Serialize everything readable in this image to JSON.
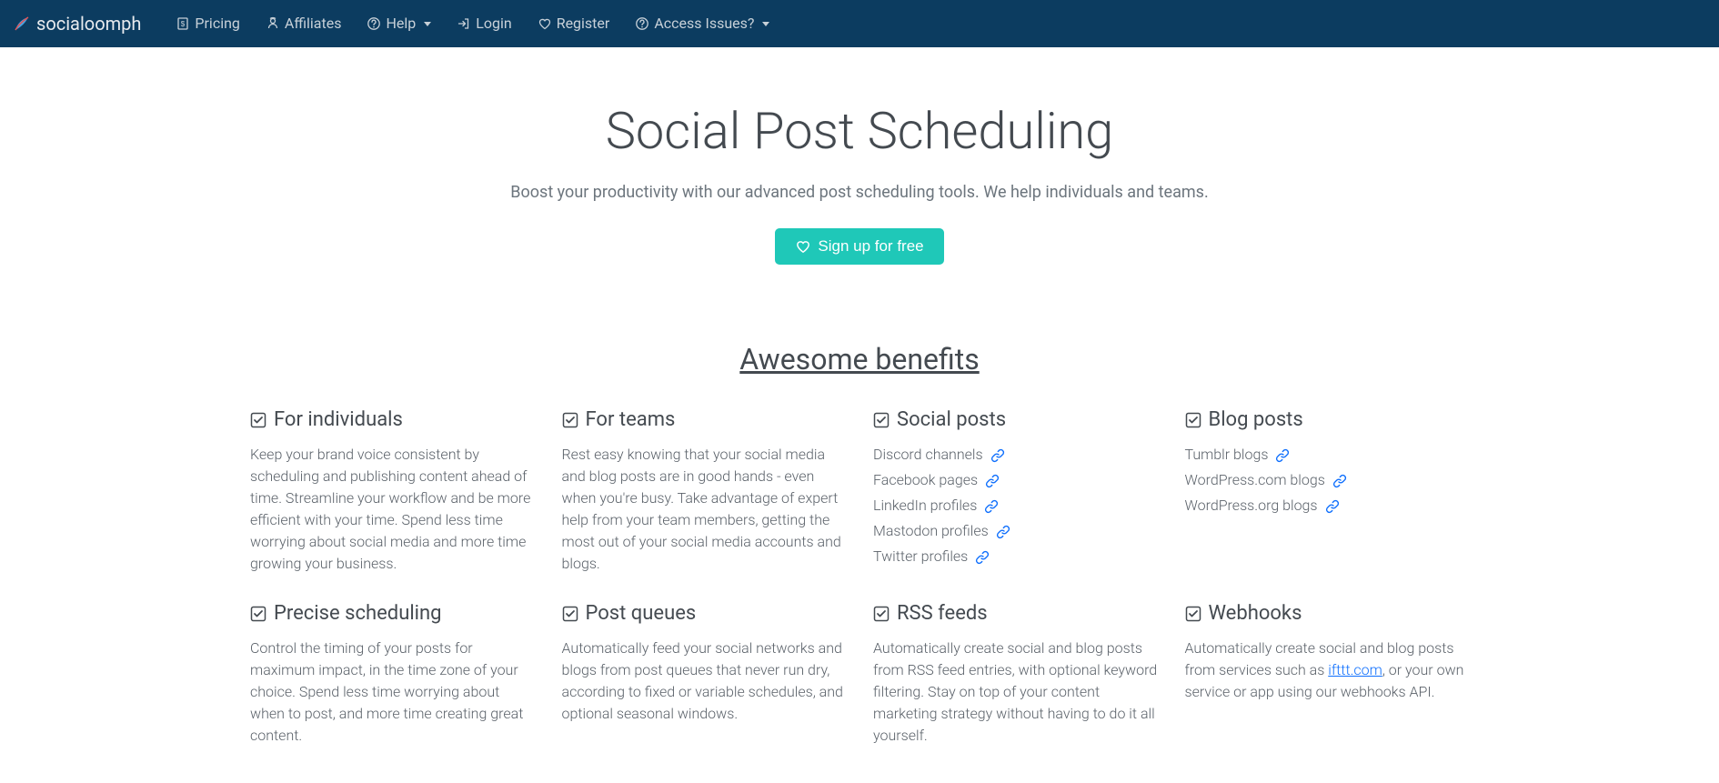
{
  "brand": "socialoomph",
  "nav": {
    "pricing": "Pricing",
    "affiliates": "Affiliates",
    "help": "Help",
    "login": "Login",
    "register": "Register",
    "access": "Access Issues?"
  },
  "hero": {
    "title": "Social Post Scheduling",
    "subtitle": "Boost your productivity with our advanced post scheduling tools. We help individuals and teams.",
    "cta": "Sign up for free"
  },
  "benefits_heading": "Awesome benefits",
  "benefits": {
    "individuals": {
      "title": "For individuals",
      "body": "Keep your brand voice consistent by scheduling and publishing content ahead of time. Streamline your workflow and be more efficient with your time. Spend less time worrying about social media and more time growing your business."
    },
    "teams": {
      "title": "For teams",
      "body": "Rest easy knowing that your social media and blog posts are in good hands - even when you're busy. Take advantage of expert help from your team members, getting the most out of your social media accounts and blogs."
    },
    "social_posts": {
      "title": "Social posts",
      "items": [
        "Discord channels",
        "Facebook pages",
        "LinkedIn profiles",
        "Mastodon profiles",
        "Twitter profiles"
      ]
    },
    "blog_posts": {
      "title": "Blog posts",
      "items": [
        "Tumblr blogs",
        "WordPress.com blogs",
        "WordPress.org blogs"
      ]
    },
    "precise": {
      "title": "Precise scheduling",
      "body": "Control the timing of your posts for maximum impact, in the time zone of your choice. Spend less time worrying about when to post, and more time creating great content."
    },
    "queues": {
      "title": "Post queues",
      "body": "Automatically feed your social networks and blogs from post queues that never run dry, according to fixed or variable schedules, and optional seasonal windows."
    },
    "rss": {
      "title": "RSS feeds",
      "body": "Automatically create social and blog posts from RSS feed entries, with optional keyword filtering. Stay on top of your content marketing strategy without having to do it all yourself."
    },
    "webhooks": {
      "title": "Webhooks",
      "body_pre": "Automatically create social and blog posts from services such as ",
      "link": "ifttt.com",
      "body_post": ", or your own service or app using our webhooks API."
    }
  }
}
